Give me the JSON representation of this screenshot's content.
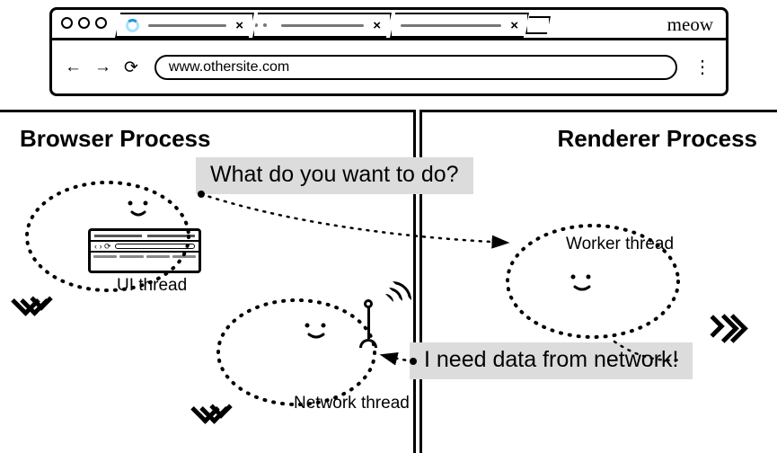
{
  "browser": {
    "brand": "meow",
    "url": "www.othersite.com",
    "nav": {
      "back": "←",
      "forward": "→",
      "reload": "⟳"
    },
    "menu": "⋮"
  },
  "processes": {
    "browser_process": "Browser Process",
    "renderer_process": "Renderer Process"
  },
  "threads": {
    "ui": "UI thread",
    "network": "Network thread",
    "worker": "Worker thread"
  },
  "bubbles": {
    "question": "What do you want to do?",
    "answer": "I need data from network!"
  }
}
